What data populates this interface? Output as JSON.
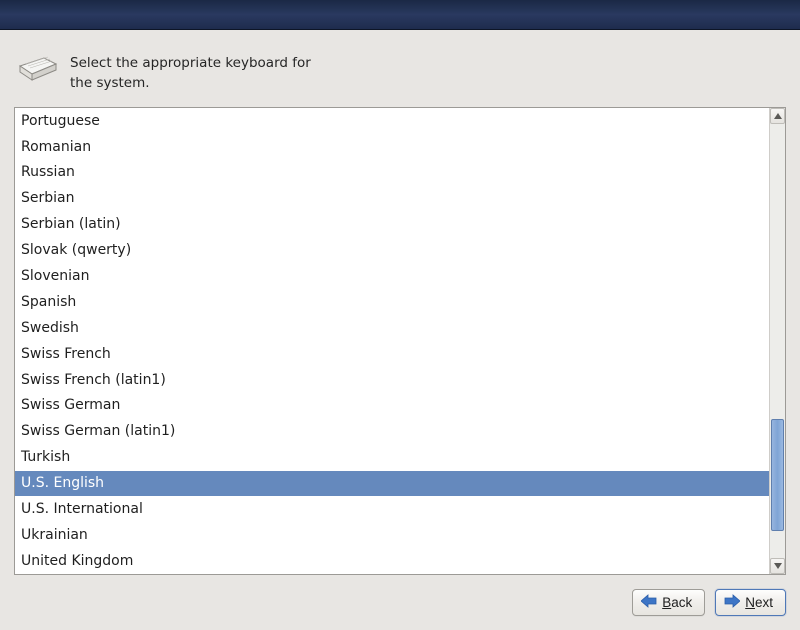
{
  "prompt": {
    "text": "Select the appropriate keyboard for the system."
  },
  "keyboard_list": {
    "items": [
      "Portuguese",
      "Romanian",
      "Russian",
      "Serbian",
      "Serbian (latin)",
      "Slovak (qwerty)",
      "Slovenian",
      "Spanish",
      "Swedish",
      "Swiss French",
      "Swiss French (latin1)",
      "Swiss German",
      "Swiss German (latin1)",
      "Turkish",
      "U.S. English",
      "U.S. International",
      "Ukrainian",
      "United Kingdom"
    ],
    "selected_index": 14
  },
  "buttons": {
    "back": "Back",
    "next": "Next"
  }
}
